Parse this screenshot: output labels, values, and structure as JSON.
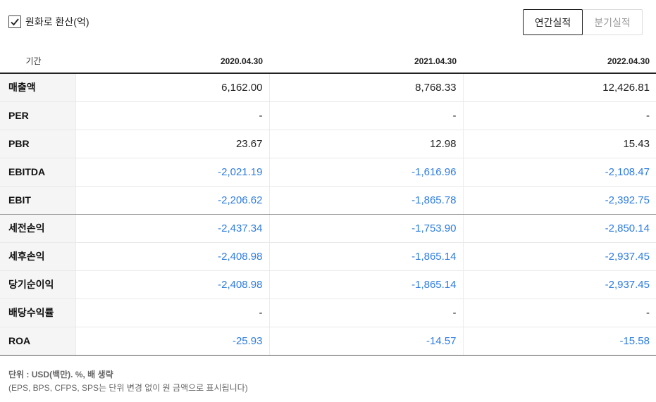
{
  "controls": {
    "convert_label": "원화로 환산(억)",
    "convert_checked": true,
    "tab_annual": "연간실적",
    "tab_quarterly": "분기실적"
  },
  "table": {
    "period_header": "기간",
    "columns": [
      "2020.04.30",
      "2021.04.30",
      "2022.04.30"
    ],
    "rows": [
      {
        "label": "매출액",
        "values": [
          "6,162.00",
          "8,768.33",
          "12,426.81"
        ]
      },
      {
        "label": "PER",
        "values": [
          "-",
          "-",
          "-"
        ]
      },
      {
        "label": "PBR",
        "values": [
          "23.67",
          "12.98",
          "15.43"
        ]
      },
      {
        "label": "EBITDA",
        "values": [
          "-2,021.19",
          "-1,616.96",
          "-2,108.47"
        ]
      },
      {
        "label": "EBIT",
        "values": [
          "-2,206.62",
          "-1,865.78",
          "-2,392.75"
        ]
      },
      {
        "label": "세전손익",
        "values": [
          "-2,437.34",
          "-1,753.90",
          "-2,850.14"
        ]
      },
      {
        "label": "세후손익",
        "values": [
          "-2,408.98",
          "-1,865.14",
          "-2,937.45"
        ]
      },
      {
        "label": "당기순이익",
        "values": [
          "-2,408.98",
          "-1,865.14",
          "-2,937.45"
        ]
      },
      {
        "label": "배당수익률",
        "values": [
          "-",
          "-",
          "-"
        ]
      },
      {
        "label": "ROA",
        "values": [
          "-25.93",
          "-14.57",
          "-15.58"
        ]
      }
    ]
  },
  "notes": {
    "unit": "단위 : USD(백만). %, 배 생략",
    "detail": "(EPS, BPS, CFPS, SPS는 단위 변경 없이 원 금액으로 표시됩니다)"
  },
  "colors": {
    "negative": "#2d7ce2",
    "label_bg": "#f5f5f5"
  }
}
